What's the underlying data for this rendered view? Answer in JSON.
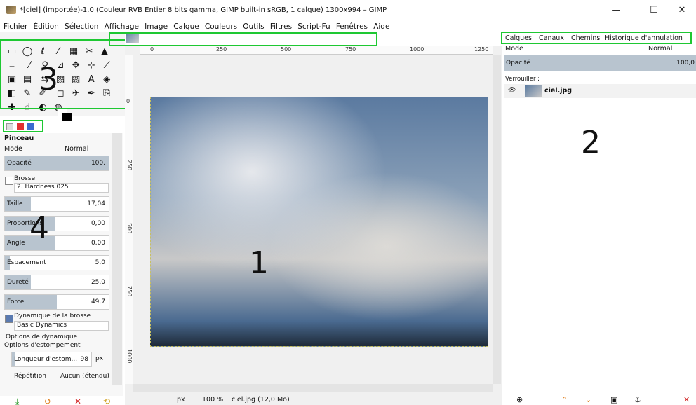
{
  "window": {
    "title": "*[ciel] (importée)-1.0 (Couleur RVB Entier 8 bits gamma, GIMP built-in sRGB, 1 calque) 1300x994 – GIMP",
    "minimize": "—",
    "maximize": "☐",
    "close": "✕"
  },
  "menu": [
    "Fichier",
    "Édition",
    "Sélection",
    "Affichage",
    "Image",
    "Calque",
    "Couleurs",
    "Outils",
    "Filtres",
    "Script-Fu",
    "Fenêtres",
    "Aide"
  ],
  "annotations": {
    "n1": "1",
    "n2": "2",
    "n3": "3",
    "n4": "4"
  },
  "ruler": {
    "t0": "0",
    "t250": "250",
    "t500": "500",
    "t750": "750",
    "t1000": "1000",
    "t1250": "1250"
  },
  "ruler_v": {
    "v0": "0",
    "v250": "250",
    "v500": "500",
    "v750": "750",
    "v1000": "1000"
  },
  "tool_options": {
    "title": "Pinceau",
    "mode_label": "Mode",
    "mode_value": "Normal",
    "opacity_label": "Opacité",
    "opacity_value": "100,",
    "brush_label": "Brosse",
    "brush_value": "2. Hardness 025",
    "size_label": "Taille",
    "size_value": "17,04",
    "proportions_label": "Proportions",
    "proportions_value": "0,00",
    "angle_label": "Angle",
    "angle_value": "0,00",
    "spacing_label": "Espacement",
    "spacing_value": "5,0",
    "hardness_label": "Dureté",
    "hardness_value": "25,0",
    "force_label": "Force",
    "force_value": "49,7",
    "dynamics_label": "Dynamique de la brosse",
    "dynamics_value": "Basic Dynamics",
    "dynamics_options": "Options de dynamique",
    "smudge_options": "Options d'estompement",
    "smudge_length_label": "Longueur d'estom...",
    "smudge_length_value": "98",
    "smudge_unit": "px",
    "repeat_label": "Répétition",
    "repeat_value": "Aucun (étendu)"
  },
  "right_tabs": {
    "layers": "Calques",
    "channels": "Canaux",
    "paths": "Chemins",
    "history": "Historique d'annulation"
  },
  "layers_panel": {
    "mode_label": "Mode",
    "mode_value": "Normal",
    "opacity_label": "Opacité",
    "opacity_value": "100,0",
    "lock_label": "Verrouiller :",
    "layer_name": "ciel.jpg"
  },
  "status": {
    "unit": "px",
    "zoom": "100 %",
    "file": "ciel.jpg (12,0 Mo)"
  }
}
